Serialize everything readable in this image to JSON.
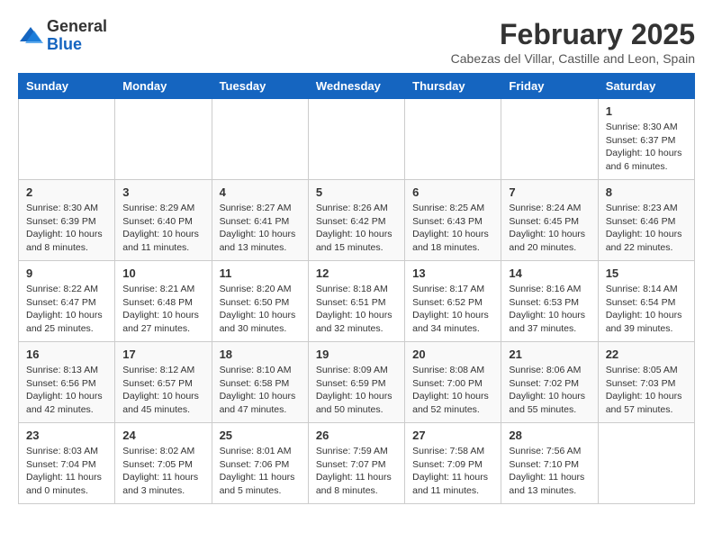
{
  "header": {
    "logo_general": "General",
    "logo_blue": "Blue",
    "month_year": "February 2025",
    "location": "Cabezas del Villar, Castille and Leon, Spain"
  },
  "weekdays": [
    "Sunday",
    "Monday",
    "Tuesday",
    "Wednesday",
    "Thursday",
    "Friday",
    "Saturday"
  ],
  "weeks": [
    [
      {
        "day": "",
        "info": ""
      },
      {
        "day": "",
        "info": ""
      },
      {
        "day": "",
        "info": ""
      },
      {
        "day": "",
        "info": ""
      },
      {
        "day": "",
        "info": ""
      },
      {
        "day": "",
        "info": ""
      },
      {
        "day": "1",
        "info": "Sunrise: 8:30 AM\nSunset: 6:37 PM\nDaylight: 10 hours and 6 minutes."
      }
    ],
    [
      {
        "day": "2",
        "info": "Sunrise: 8:30 AM\nSunset: 6:39 PM\nDaylight: 10 hours and 8 minutes."
      },
      {
        "day": "3",
        "info": "Sunrise: 8:29 AM\nSunset: 6:40 PM\nDaylight: 10 hours and 11 minutes."
      },
      {
        "day": "4",
        "info": "Sunrise: 8:27 AM\nSunset: 6:41 PM\nDaylight: 10 hours and 13 minutes."
      },
      {
        "day": "5",
        "info": "Sunrise: 8:26 AM\nSunset: 6:42 PM\nDaylight: 10 hours and 15 minutes."
      },
      {
        "day": "6",
        "info": "Sunrise: 8:25 AM\nSunset: 6:43 PM\nDaylight: 10 hours and 18 minutes."
      },
      {
        "day": "7",
        "info": "Sunrise: 8:24 AM\nSunset: 6:45 PM\nDaylight: 10 hours and 20 minutes."
      },
      {
        "day": "8",
        "info": "Sunrise: 8:23 AM\nSunset: 6:46 PM\nDaylight: 10 hours and 22 minutes."
      }
    ],
    [
      {
        "day": "9",
        "info": "Sunrise: 8:22 AM\nSunset: 6:47 PM\nDaylight: 10 hours and 25 minutes."
      },
      {
        "day": "10",
        "info": "Sunrise: 8:21 AM\nSunset: 6:48 PM\nDaylight: 10 hours and 27 minutes."
      },
      {
        "day": "11",
        "info": "Sunrise: 8:20 AM\nSunset: 6:50 PM\nDaylight: 10 hours and 30 minutes."
      },
      {
        "day": "12",
        "info": "Sunrise: 8:18 AM\nSunset: 6:51 PM\nDaylight: 10 hours and 32 minutes."
      },
      {
        "day": "13",
        "info": "Sunrise: 8:17 AM\nSunset: 6:52 PM\nDaylight: 10 hours and 34 minutes."
      },
      {
        "day": "14",
        "info": "Sunrise: 8:16 AM\nSunset: 6:53 PM\nDaylight: 10 hours and 37 minutes."
      },
      {
        "day": "15",
        "info": "Sunrise: 8:14 AM\nSunset: 6:54 PM\nDaylight: 10 hours and 39 minutes."
      }
    ],
    [
      {
        "day": "16",
        "info": "Sunrise: 8:13 AM\nSunset: 6:56 PM\nDaylight: 10 hours and 42 minutes."
      },
      {
        "day": "17",
        "info": "Sunrise: 8:12 AM\nSunset: 6:57 PM\nDaylight: 10 hours and 45 minutes."
      },
      {
        "day": "18",
        "info": "Sunrise: 8:10 AM\nSunset: 6:58 PM\nDaylight: 10 hours and 47 minutes."
      },
      {
        "day": "19",
        "info": "Sunrise: 8:09 AM\nSunset: 6:59 PM\nDaylight: 10 hours and 50 minutes."
      },
      {
        "day": "20",
        "info": "Sunrise: 8:08 AM\nSunset: 7:00 PM\nDaylight: 10 hours and 52 minutes."
      },
      {
        "day": "21",
        "info": "Sunrise: 8:06 AM\nSunset: 7:02 PM\nDaylight: 10 hours and 55 minutes."
      },
      {
        "day": "22",
        "info": "Sunrise: 8:05 AM\nSunset: 7:03 PM\nDaylight: 10 hours and 57 minutes."
      }
    ],
    [
      {
        "day": "23",
        "info": "Sunrise: 8:03 AM\nSunset: 7:04 PM\nDaylight: 11 hours and 0 minutes."
      },
      {
        "day": "24",
        "info": "Sunrise: 8:02 AM\nSunset: 7:05 PM\nDaylight: 11 hours and 3 minutes."
      },
      {
        "day": "25",
        "info": "Sunrise: 8:01 AM\nSunset: 7:06 PM\nDaylight: 11 hours and 5 minutes."
      },
      {
        "day": "26",
        "info": "Sunrise: 7:59 AM\nSunset: 7:07 PM\nDaylight: 11 hours and 8 minutes."
      },
      {
        "day": "27",
        "info": "Sunrise: 7:58 AM\nSunset: 7:09 PM\nDaylight: 11 hours and 11 minutes."
      },
      {
        "day": "28",
        "info": "Sunrise: 7:56 AM\nSunset: 7:10 PM\nDaylight: 11 hours and 13 minutes."
      },
      {
        "day": "",
        "info": ""
      }
    ]
  ]
}
